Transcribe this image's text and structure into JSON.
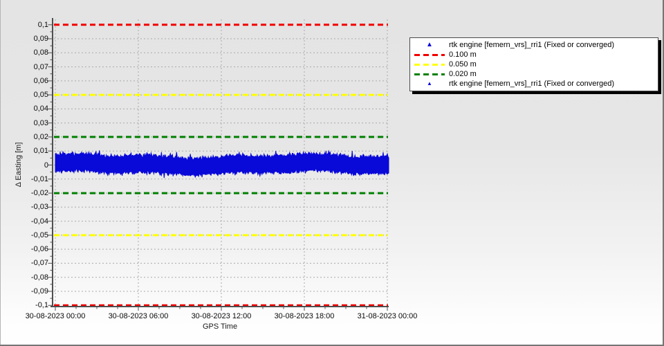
{
  "chart_data": {
    "type": "scatter",
    "title": "",
    "xlabel": "GPS Time",
    "ylabel": "Δ Easting [m]",
    "x_tick_labels": [
      "30-08-2023 00:00",
      "30-08-2023 06:00",
      "30-08-2023 12:00",
      "30-08-2023 18:00",
      "31-08-2023 00:00"
    ],
    "y_tick_labels": [
      "0,1",
      "0,09",
      "0,08",
      "0,07",
      "0,06",
      "0,05",
      "0,04",
      "0,03",
      "0,02",
      "0,01",
      "0",
      "-0,01",
      "-0,02",
      "-0,03",
      "-0,04",
      "-0,05",
      "-0,06",
      "-0,07",
      "-0,08",
      "-0,09",
      "-0,1"
    ],
    "y_tick_values": [
      0.1,
      0.09,
      0.08,
      0.07,
      0.06,
      0.05,
      0.04,
      0.03,
      0.02,
      0.01,
      0,
      -0.01,
      -0.02,
      -0.03,
      -0.04,
      -0.05,
      -0.06,
      -0.07,
      -0.08,
      -0.09,
      -0.1
    ],
    "ylim": [
      -0.1,
      0.1
    ],
    "x_range": [
      "30-08-2023 00:00",
      "31-08-2023 00:00"
    ],
    "grid": true,
    "legend_position": "top-right",
    "thresholds": [
      {
        "label": "0.100 m",
        "value_m": 0.1,
        "color": "#f20000",
        "style": "dashed",
        "mirrored_negative": true
      },
      {
        "label": "0.050 m",
        "value_m": 0.05,
        "color": "#ffff00",
        "style": "dashed",
        "mirrored_negative": true
      },
      {
        "label": "0.020 m",
        "value_m": 0.02,
        "color": "#008000",
        "style": "dashed",
        "mirrored_negative": true
      }
    ],
    "series": [
      {
        "name": "rtk engine [femern_vrs]_rri1 (Fixed or converged)",
        "color": "#0909d8",
        "marker": "triangle",
        "description": "dense noise band of Δ Easting residuals centered on 0 m for 24 h",
        "mean_m": 0.0,
        "typical_half_spread_m": 0.006,
        "peak_m": 0.012,
        "n_points": 484,
        "seed": 42
      }
    ]
  },
  "legend": {
    "entries": [
      {
        "marker": "triangle",
        "color": "#0909d8",
        "label": "rtk engine [femern_vrs]_rri1 (Fixed or converged)"
      },
      {
        "marker": "dashes",
        "color": "#f20000",
        "label": "0.100 m"
      },
      {
        "marker": "dashes",
        "color": "#ffff00",
        "label": "0.050 m"
      },
      {
        "marker": "dashes",
        "color": "#008000",
        "label": "0.020 m"
      },
      {
        "marker": "triangle-small",
        "color": "#0909d8",
        "label": "rtk engine [femern_vrs]_rri1 (Fixed or converged)"
      }
    ]
  }
}
